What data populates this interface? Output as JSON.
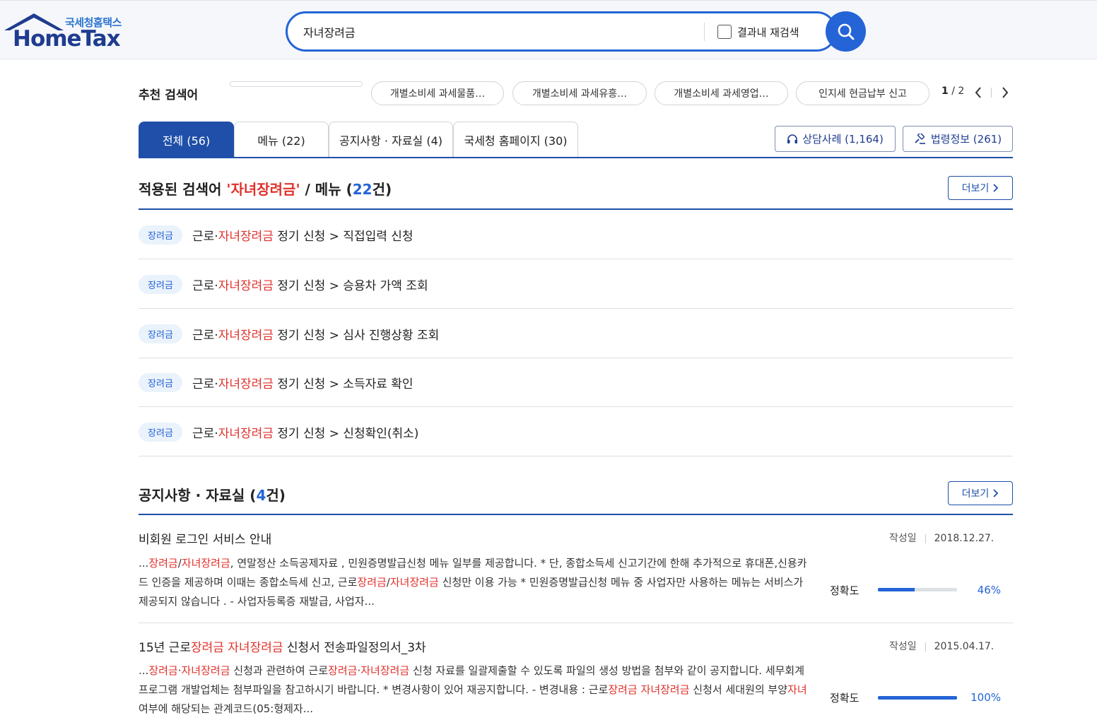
{
  "header": {
    "logo_sub": "국세청홈택스",
    "logo_main": "HomeTax",
    "search_value": "자녀장려금",
    "research_label": "결과내 재검색"
  },
  "recommend": {
    "title": "추천 검색어",
    "chips": [
      "개별소비세 과세물품…",
      "개별소비세 과세유흥…",
      "개별소비세 과세영업…",
      "인지세 현금납부 신고"
    ],
    "page_current": "1",
    "page_total": "/ 2"
  },
  "tabs": [
    {
      "label": "전체 (56)"
    },
    {
      "label": "메뉴 (22)"
    },
    {
      "label": "공지사항 · 자료실 (4)"
    },
    {
      "label": "국세청 홈페이지 (30)"
    }
  ],
  "right_buttons": {
    "consult": "상담사례 (1,164)",
    "law": "법령정보 (261)"
  },
  "menu_section": {
    "prefix": "적용된 검색어 ",
    "keyword": "'자녀장려금'",
    "mid": " / 메뉴 (",
    "count": "22",
    "suffix": "건)",
    "more": "더보기",
    "rows": [
      {
        "badge": "장려금",
        "pre": "근로·",
        "hl": "자녀장려금",
        "post": " 정기 신청 > 직접입력 신청"
      },
      {
        "badge": "장려금",
        "pre": "근로·",
        "hl": "자녀장려금",
        "post": " 정기 신청 > 승용차 가액 조회"
      },
      {
        "badge": "장려금",
        "pre": "근로·",
        "hl": "자녀장려금",
        "post": " 정기 신청 > 심사 진행상황 조회"
      },
      {
        "badge": "장려금",
        "pre": "근로·",
        "hl": "자녀장려금",
        "post": " 정기 신청 > 소득자료 확인"
      },
      {
        "badge": "장려금",
        "pre": "근로·",
        "hl": "자녀장려금",
        "post": " 정기 신청 > 신청확인(취소)"
      }
    ]
  },
  "notice_section": {
    "prefix": "공지사항 · 자료실 (",
    "count": "4",
    "suffix": "건)",
    "more": "더보기",
    "items": [
      {
        "title": "비회원 로그인 서비스 안내",
        "date_label": "작성일",
        "date": "2018.12.27.",
        "accuracy_label": "정확도",
        "accuracy": "46%",
        "accuracy_value": 0.46
      },
      {
        "title_pre": "15년 근로",
        "title_hl1": "장려금",
        "title_mid": " ",
        "title_hl2": "자녀장려금",
        "title_post": " 신청서 전송파일정의서_3차",
        "date_label": "작성일",
        "date": "2015.04.17.",
        "accuracy_label": "정확도",
        "accuracy": "100%",
        "accuracy_value": 1.0
      }
    ],
    "body1": [
      {
        "t": "...",
        "h": false
      },
      {
        "t": "장려금",
        "h": true
      },
      {
        "t": "/",
        "h": false
      },
      {
        "t": "자녀장려금",
        "h": true
      },
      {
        "t": ", 연말정산 소득공제자료 , 민원증명발급신청 메뉴 일부를 제공합니다. * 단, 종합소득세 신고기간에 한해 추가적으로 휴대폰,신용카드 인증을 제공하며 이때는 종합소득세 신고, 근로",
        "h": false
      },
      {
        "t": "장려금",
        "h": true
      },
      {
        "t": "/",
        "h": false
      },
      {
        "t": "자녀장려금",
        "h": true
      },
      {
        "t": " 신청만 이용 가능 * 민원증명발급신청 메뉴 중 사업자만 사용하는 메뉴는 서비스가 제공되지 않습니다 . - 사업자등록증 재발급, 사업자...",
        "h": false
      }
    ],
    "body2": [
      {
        "t": "...",
        "h": false
      },
      {
        "t": "장려금",
        "h": true
      },
      {
        "t": "·",
        "h": false
      },
      {
        "t": "자녀장려금",
        "h": true
      },
      {
        "t": " 신청과 관련하여 근로",
        "h": false
      },
      {
        "t": "장려금",
        "h": true
      },
      {
        "t": "·",
        "h": false
      },
      {
        "t": "자녀장려금",
        "h": true
      },
      {
        "t": " 신청 자료를 일괄제출할 수 있도록 파일의 생성 방법을 첨부와 같이 공지합니다. 세무회계 프로그램 개발업체는 첨부파일을 참고하시기 바랍니다. * 변경사항이 있어 재공지합니다. - 변경내용 : 근로",
        "h": false
      },
      {
        "t": "장려금",
        "h": true
      },
      {
        "t": " ",
        "h": false
      },
      {
        "t": "자녀장려금",
        "h": true
      },
      {
        "t": " 신청서 세대원의 부양",
        "h": false
      },
      {
        "t": "자녀",
        "h": true
      },
      {
        "t": "여부에 해당되는 관계코드(05:형제자...",
        "h": false
      }
    ]
  },
  "colors": {
    "brand": "#1f4fa8",
    "accent": "#2464d6",
    "highlight": "#e0312b"
  }
}
